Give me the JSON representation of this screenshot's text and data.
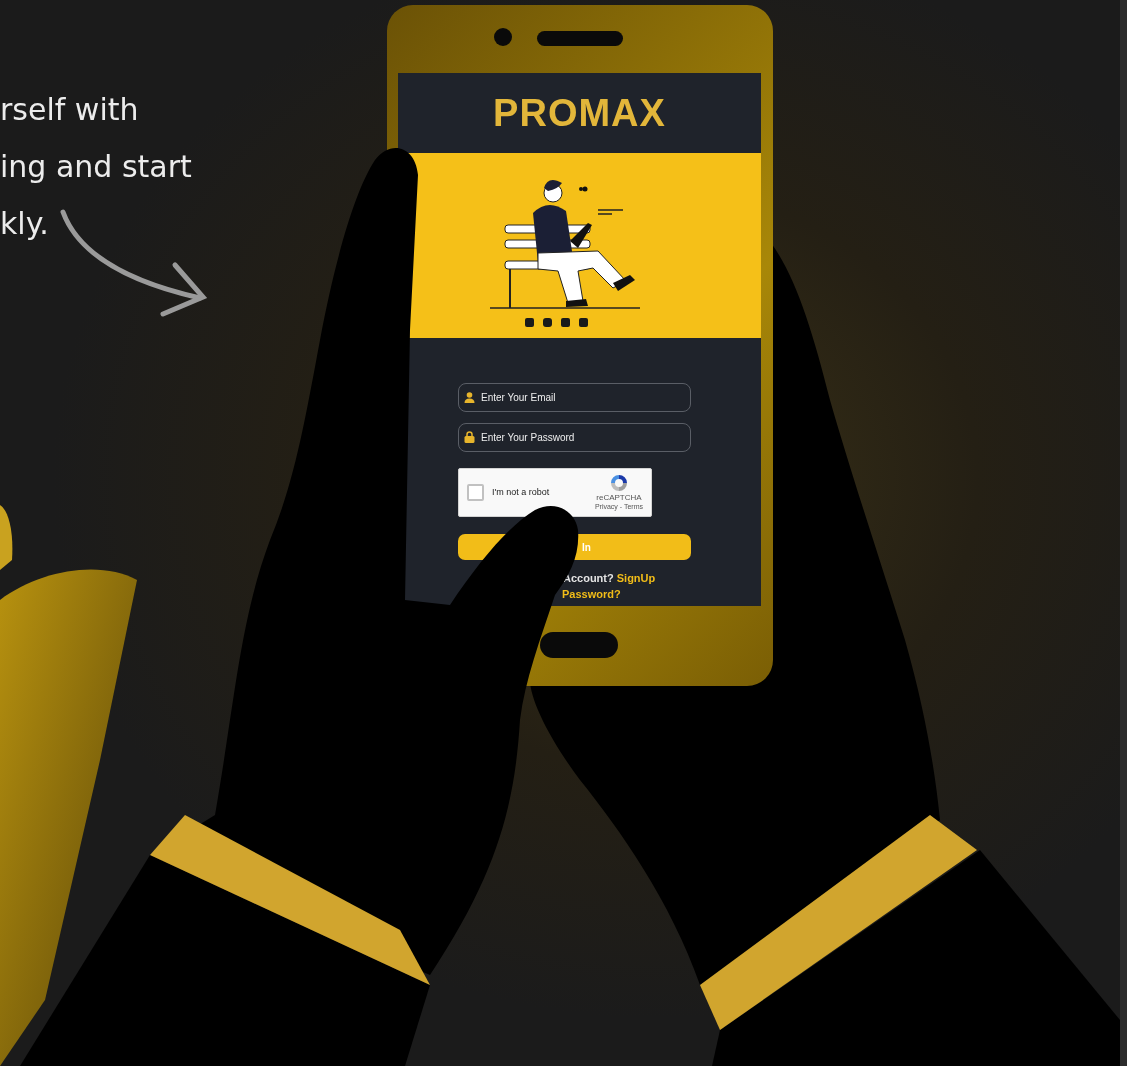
{
  "intro_text_lines": [
    "rself with",
    "ing and start",
    "kly."
  ],
  "phone_screen": {
    "brand": "PROMAX",
    "login_form": {
      "email": {
        "placeholder": "Enter Your Email"
      },
      "password": {
        "placeholder": "Enter Your Password"
      },
      "captcha": {
        "label": "I'm not a robot",
        "checked": false,
        "brand": "reCAPTCHA",
        "links": "Privacy - Terms"
      },
      "submit_button": "In",
      "signup_prompt": "Account?",
      "signup_link": "SignUp",
      "forgot_link": "Password?"
    }
  }
}
